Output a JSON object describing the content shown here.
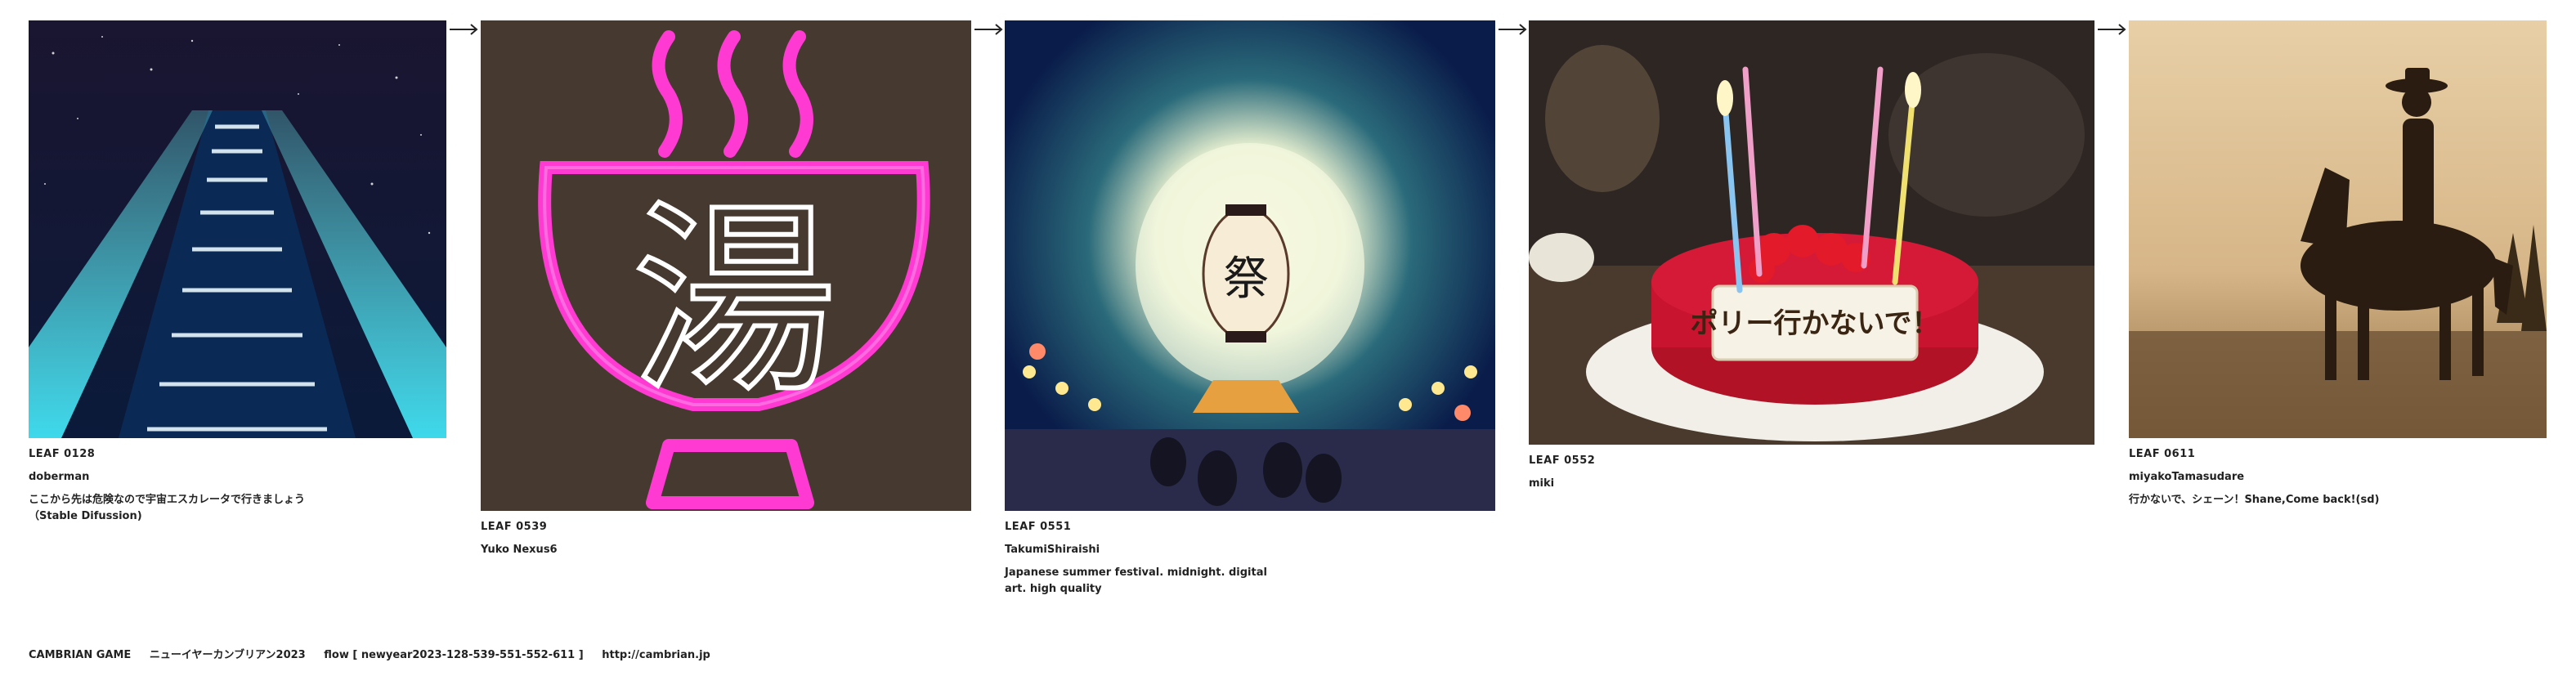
{
  "cards": [
    {
      "leaf": "LEAF 0128",
      "author": "doberman",
      "caption": "ここから先は危険なので宇宙エスカレータで行きましょう（Stable Difussion)",
      "image": "escalator-in-space"
    },
    {
      "leaf": "LEAF 0539",
      "author": "Yuko Nexus6",
      "caption": "",
      "image": "neon-yu-sign"
    },
    {
      "leaf": "LEAF 0551",
      "author": "TakumiShiraishi",
      "caption": "Japanese summer festival. midnight. digital art. high quality",
      "image": "festival-lantern"
    },
    {
      "leaf": "LEAF 0552",
      "author": "miki",
      "caption": "",
      "image": "birthday-cake"
    },
    {
      "leaf": "LEAF 0611",
      "author": "miyakoTamasudare",
      "caption": "行かないで、シェーン！Shane,Come back!(sd)",
      "image": "cowboy-on-horse"
    }
  ],
  "cake_text": "ポリー行かないで！",
  "lantern_text": "祭",
  "sign_text": "湯",
  "arrow_icon": "arrow-right-icon",
  "footer": {
    "brand": "CAMBRIAN GAME",
    "title": "ニューイヤーカンブリアン2023",
    "flow": "flow [ newyear2023-128-539-551-552-611 ]",
    "url": "http://cambrian.jp"
  }
}
